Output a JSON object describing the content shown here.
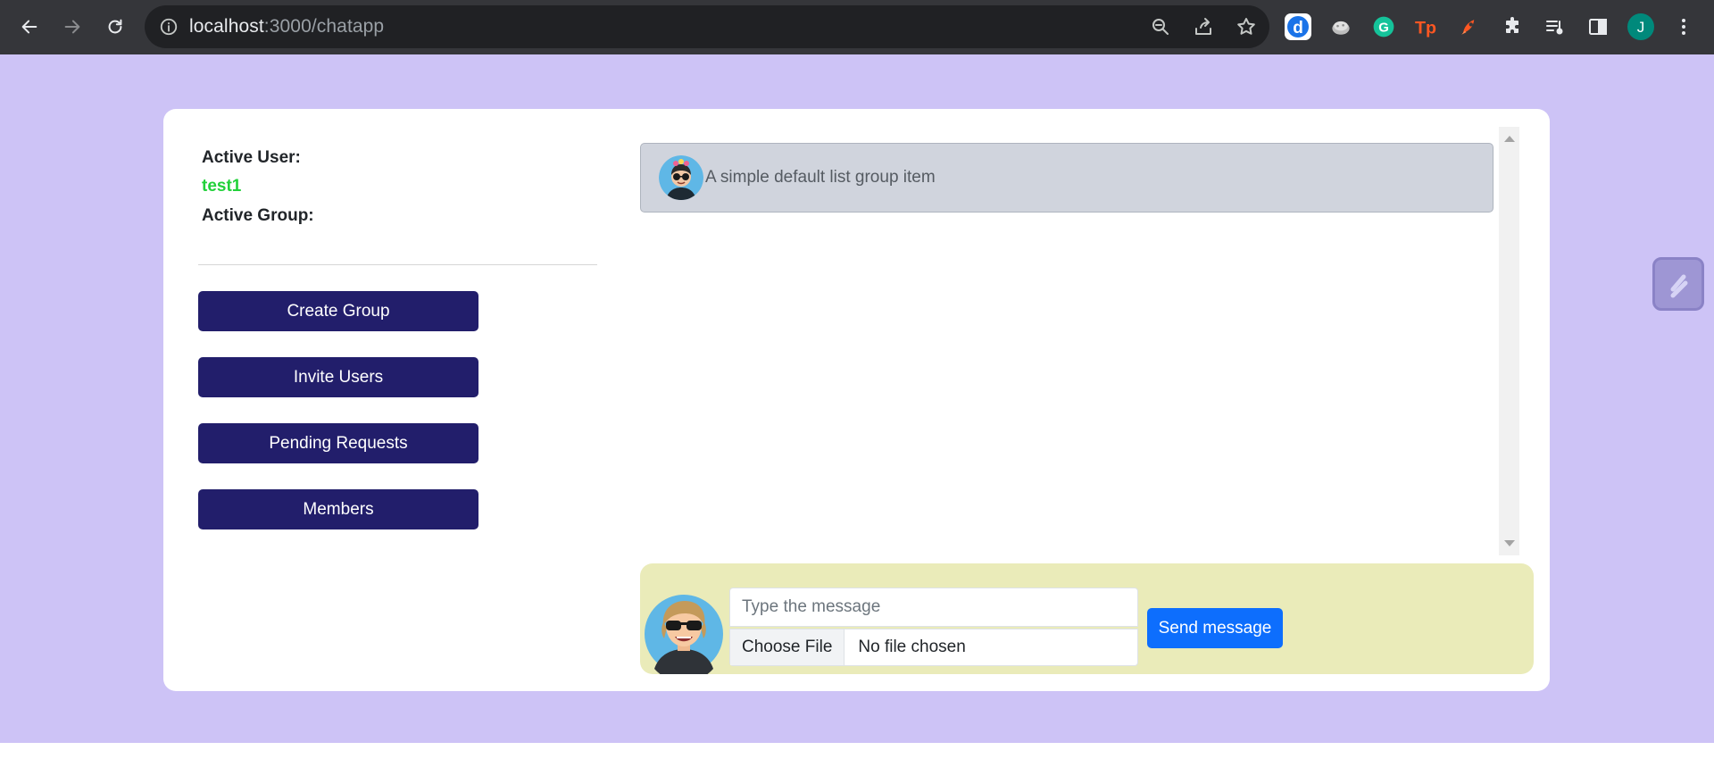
{
  "browser": {
    "url_host": "localhost",
    "url_path": ":3000/chatapp",
    "profile_initial": "J",
    "icons": [
      "back-icon",
      "forward-icon",
      "reload-icon",
      "site-info-icon",
      "zoom-icon",
      "share-icon",
      "bookmark-star-icon",
      "dict-extension-icon",
      "cookie-extension-icon",
      "grammarly-icon",
      "tp-extension-icon",
      "rocket-extension-icon",
      "extensions-puzzle-icon",
      "reading-list-icon",
      "side-panel-icon",
      "menu-dots-icon"
    ]
  },
  "sidebar": {
    "active_user_label": "Active User:",
    "active_user_value": "test1",
    "active_group_label": "Active Group:",
    "buttons": [
      "Create Group",
      "Invite Users",
      "Pending Requests",
      "Members"
    ]
  },
  "messages": [
    {
      "text": "A simple default list group item"
    }
  ],
  "compose": {
    "placeholder": "Type the message",
    "file_button": "Choose File",
    "file_status": "No file chosen",
    "send_label": "Send message"
  },
  "colors": {
    "page_bg": "#cdc3f6",
    "action_button": "#221e6b",
    "send_button": "#0d6efd",
    "active_user": "#22d13a",
    "compose_bg": "#eaebb9",
    "message_bg": "#d0d4dd"
  }
}
